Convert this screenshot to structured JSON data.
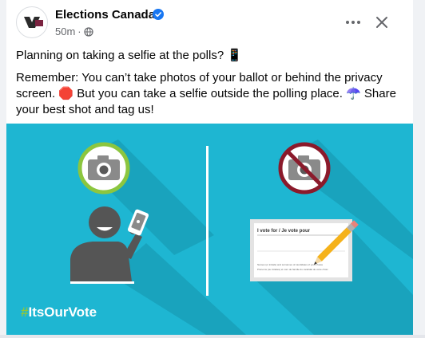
{
  "post": {
    "page_name": "Elections Canada",
    "timestamp": "50m",
    "separator": "·",
    "audience_icon": "globe-icon",
    "line1": "Planning on taking a selfie at the polls? 📱",
    "line2": "Remember: You can’t take photos of your ballot or behind the privacy screen. 🛑 But you can take a selfie outside the polling place. ☂️ Share your best shot and tag us!"
  },
  "media": {
    "hashtag_symbol": "#",
    "hashtag_text": "ItsOurVote",
    "ballot_title": "I vote for / Je vote pour",
    "ballot_instructions_en": "Names (or initials) and surnames of candidates of your choice",
    "ballot_instructions_fr": "Prénoms (ou initiales) et nom de famille du candidat de votre choix"
  },
  "icons": {
    "more": "more-options-icon",
    "close": "close-icon",
    "verified": "verified-badge-icon"
  },
  "colors": {
    "media_background": "#1eb6d2",
    "allowed_ring": "#8cc63f",
    "forbidden_ring": "#8b1a2b",
    "verified_blue": "#1877f2",
    "hashtag_green": "#8dc63f"
  }
}
